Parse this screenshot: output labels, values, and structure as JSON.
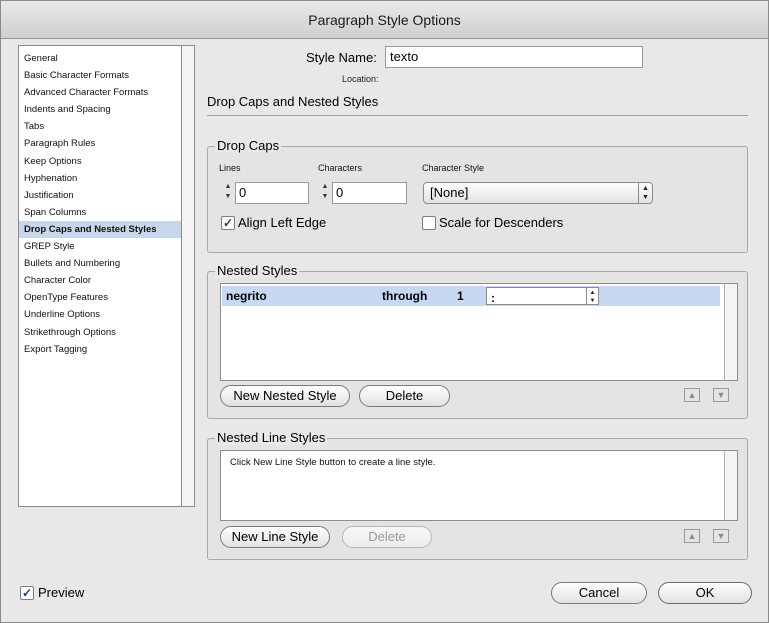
{
  "window": {
    "title": "Paragraph Style Options"
  },
  "sidebar": {
    "items": [
      {
        "label": "General"
      },
      {
        "label": "Basic Character Formats"
      },
      {
        "label": "Advanced Character Formats"
      },
      {
        "label": "Indents and Spacing"
      },
      {
        "label": "Tabs"
      },
      {
        "label": "Paragraph Rules"
      },
      {
        "label": "Keep Options"
      },
      {
        "label": "Hyphenation"
      },
      {
        "label": "Justification"
      },
      {
        "label": "Span Columns"
      },
      {
        "label": "Drop Caps and Nested Styles",
        "selected": true
      },
      {
        "label": "GREP Style"
      },
      {
        "label": "Bullets and Numbering"
      },
      {
        "label": "Character Color"
      },
      {
        "label": "OpenType Features"
      },
      {
        "label": "Underline Options"
      },
      {
        "label": "Strikethrough Options"
      },
      {
        "label": "Export Tagging"
      }
    ]
  },
  "header": {
    "style_name_label": "Style Name:",
    "style_name_value": "texto",
    "location_label": "Location:",
    "section_title": "Drop Caps and Nested Styles"
  },
  "drop_caps": {
    "title": "Drop Caps",
    "lines_label": "Lines",
    "lines_value": "0",
    "characters_label": "Characters",
    "characters_value": "0",
    "char_style_label": "Character Style",
    "char_style_value": "[None]",
    "align_left_edge_label": "Align Left Edge",
    "align_left_edge_checked": true,
    "scale_descenders_label": "Scale for Descenders",
    "scale_descenders_checked": false
  },
  "nested_styles": {
    "title": "Nested Styles",
    "rows": [
      {
        "style": "negrito",
        "mode": "through",
        "count": "1",
        "delimiter": ":"
      }
    ],
    "new_button": "New Nested Style",
    "delete_button": "Delete"
  },
  "nested_line_styles": {
    "title": "Nested Line Styles",
    "hint": "Click New Line Style button to create a line style.",
    "new_button": "New Line Style",
    "delete_button": "Delete"
  },
  "footer": {
    "preview_label": "Preview",
    "preview_checked": true,
    "cancel_button": "Cancel",
    "ok_button": "OK"
  },
  "icons": {
    "spin_up": "▲",
    "spin_down": "▼",
    "move_up": "▲",
    "move_down": "▼",
    "check": "✓"
  },
  "colors": {
    "selection": "#c8d6ec",
    "window_bg": "#e8e8e8"
  }
}
